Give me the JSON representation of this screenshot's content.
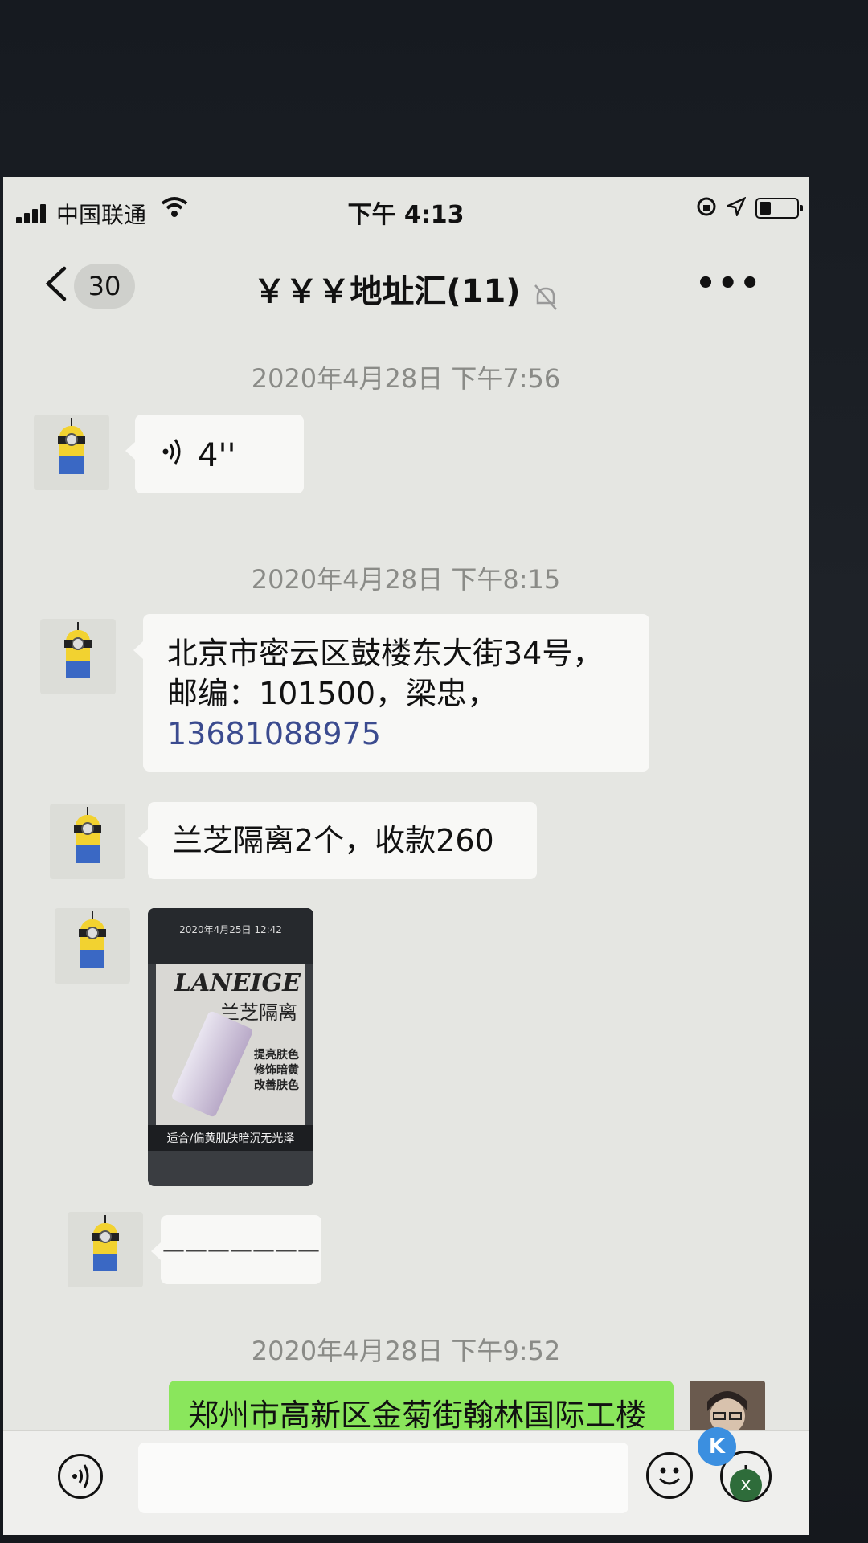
{
  "status_bar": {
    "carrier": "中国联通",
    "time": "下午 4:13",
    "battery_level": 0.35
  },
  "nav": {
    "unread_count": "30",
    "title": "￥￥￥地址汇(11)",
    "more": "•••"
  },
  "messages": [
    {
      "type": "timestamp",
      "text": "2020年4月28日 下午7:56"
    },
    {
      "type": "voice",
      "duration": "4''"
    },
    {
      "type": "timestamp",
      "text": "2020年4月28日 下午8:15"
    },
    {
      "type": "text",
      "line1": "北京市密云区鼓楼东大街34号，",
      "line2": "邮编：101500，梁忠，",
      "phone": "13681088975"
    },
    {
      "type": "text",
      "text": "兰芝隔离2个，收款260"
    },
    {
      "type": "image",
      "header": "2020年4月25日 12:42",
      "brand": "LANEIGE",
      "product": "兰芝隔离",
      "tags": [
        "提亮肤色",
        "修饰暗黄",
        "改善肤色"
      ],
      "caption": "适合/偏黄肌肤暗沉无光泽"
    },
    {
      "type": "text",
      "text": "———————"
    },
    {
      "type": "timestamp",
      "text": "2020年4月28日 下午9:52"
    },
    {
      "type": "text_mine",
      "text": "郑州市高新区金菊街翰林国际工楼"
    }
  ],
  "floating": {
    "k_label": "K",
    "x_label": "x"
  }
}
